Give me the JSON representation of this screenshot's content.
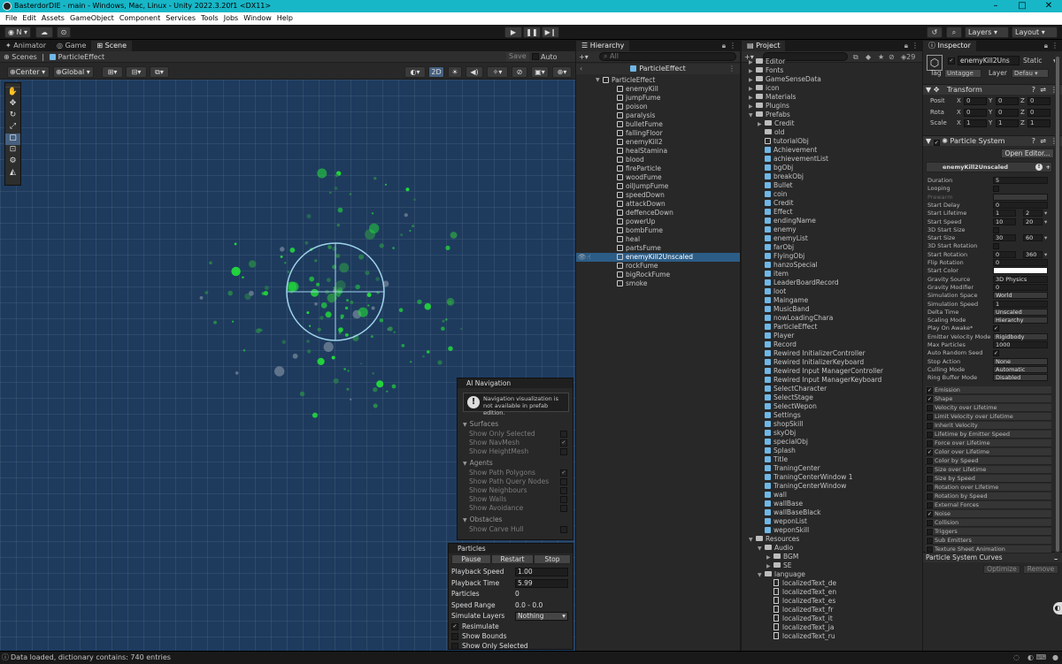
{
  "window": {
    "title": "BasterdorDIE - main - Windows, Mac, Linux - Unity 2022.3.20f1 <DX11>"
  },
  "menu": [
    "File",
    "Edit",
    "Assets",
    "GameObject",
    "Component",
    "Services",
    "Tools",
    "Jobs",
    "Window",
    "Help"
  ],
  "toolbar": {
    "account": "N",
    "layers": "Layers",
    "layout": "Layout"
  },
  "scene_panel": {
    "tabs": [
      "Animator",
      "Game",
      "Scene"
    ],
    "breadcrumb_root": "Scenes",
    "breadcrumb_item": "ParticleEffect",
    "save": "Save",
    "auto_save": "Auto Save",
    "pivot": "Center",
    "space": "Global",
    "mode_2d": "2D"
  },
  "ai_navigation": {
    "title": "AI Navigation",
    "notice": "Navigation visualization is not available in prefab edition.",
    "surfaces_label": "Surfaces",
    "surfaces": [
      {
        "label": "Show Only Selected",
        "checked": false
      },
      {
        "label": "Show NavMesh",
        "checked": true
      },
      {
        "label": "Show HeightMesh",
        "checked": false
      }
    ],
    "agents_label": "Agents",
    "agents": [
      {
        "label": "Show Path Polygons",
        "checked": true
      },
      {
        "label": "Show Path Query Nodes",
        "checked": false
      },
      {
        "label": "Show Neighbours",
        "checked": false
      },
      {
        "label": "Show Walls",
        "checked": false
      },
      {
        "label": "Show Avoidance",
        "checked": false
      }
    ],
    "obstacles_label": "Obstacles",
    "obstacles": [
      {
        "label": "Show Carve Hull",
        "checked": false
      }
    ]
  },
  "particles_overlay": {
    "title": "Particles",
    "pause": "Pause",
    "restart": "Restart",
    "stop": "Stop",
    "playback_speed_label": "Playback Speed",
    "playback_speed": "1.00",
    "playback_time_label": "Playback Time",
    "playback_time": "5.99",
    "particles_label": "Particles",
    "particles": "0",
    "speed_range_label": "Speed Range",
    "speed_range": "0.0 - 0.0",
    "simulate_layers_label": "Simulate Layers",
    "simulate_layers": "Nothing",
    "resimulate": "Resimulate",
    "show_bounds": "Show Bounds",
    "show_only_selected": "Show Only Selected"
  },
  "hierarchy": {
    "tab": "Hierarchy",
    "search_placeholder": "All",
    "root": "ParticleEffect",
    "parent": "ParticleEffect",
    "children": [
      "enemyKill",
      "jumpFume",
      "poison",
      "paralysis",
      "bulletFume",
      "fallingFloor",
      "enemyKill2",
      "healStamina",
      "blood",
      "fireParticle",
      "woodFume",
      "oilJumpFume",
      "speedDown",
      "attackDown",
      "deffenceDown",
      "powerUp",
      "bombFume",
      "heal",
      "partsFume",
      "enemyKill2Unscaled",
      "rockFume",
      "bigRockFume",
      "smoke"
    ],
    "selected": "enemyKill2Unscaled"
  },
  "project": {
    "tab": "Project",
    "count": "29",
    "items": [
      {
        "d": 1,
        "t": "folder",
        "n": "Editor",
        "a": "▶"
      },
      {
        "d": 1,
        "t": "folder",
        "n": "Fonts",
        "a": "▶"
      },
      {
        "d": 1,
        "t": "folder",
        "n": "GameSenseData",
        "a": "▶"
      },
      {
        "d": 1,
        "t": "folder",
        "n": "icon",
        "a": "▶"
      },
      {
        "d": 1,
        "t": "folder",
        "n": "Materials",
        "a": "▶"
      },
      {
        "d": 1,
        "t": "folder",
        "n": "Plugins",
        "a": "▶"
      },
      {
        "d": 1,
        "t": "folder",
        "n": "Prefabs",
        "a": "▼"
      },
      {
        "d": 2,
        "t": "folder",
        "n": "Credit",
        "a": "▶"
      },
      {
        "d": 2,
        "t": "folder",
        "n": "old",
        "a": ""
      },
      {
        "d": 2,
        "t": "cubeo",
        "n": "tutorialObj",
        "a": ""
      },
      {
        "d": 2,
        "t": "cube",
        "n": "Achievement",
        "a": ""
      },
      {
        "d": 2,
        "t": "cube",
        "n": "achievementList",
        "a": ""
      },
      {
        "d": 2,
        "t": "cube",
        "n": "bgObj",
        "a": ""
      },
      {
        "d": 2,
        "t": "cube",
        "n": "breakObj",
        "a": ""
      },
      {
        "d": 2,
        "t": "cube",
        "n": "Bullet",
        "a": ""
      },
      {
        "d": 2,
        "t": "cube",
        "n": "coin",
        "a": ""
      },
      {
        "d": 2,
        "t": "cube",
        "n": "Credit",
        "a": ""
      },
      {
        "d": 2,
        "t": "cube",
        "n": "Effect",
        "a": ""
      },
      {
        "d": 2,
        "t": "cube",
        "n": "endingName",
        "a": ""
      },
      {
        "d": 2,
        "t": "cube",
        "n": "enemy",
        "a": ""
      },
      {
        "d": 2,
        "t": "cube",
        "n": "enemyList",
        "a": ""
      },
      {
        "d": 2,
        "t": "cube",
        "n": "farObj",
        "a": ""
      },
      {
        "d": 2,
        "t": "cube",
        "n": "FlyingObj",
        "a": ""
      },
      {
        "d": 2,
        "t": "cube",
        "n": "hanzoSpecial",
        "a": ""
      },
      {
        "d": 2,
        "t": "cube",
        "n": "item",
        "a": ""
      },
      {
        "d": 2,
        "t": "cube",
        "n": "LeaderBoardRecord",
        "a": ""
      },
      {
        "d": 2,
        "t": "cube",
        "n": "loot",
        "a": ""
      },
      {
        "d": 2,
        "t": "cube",
        "n": "Maingame",
        "a": ""
      },
      {
        "d": 2,
        "t": "cube",
        "n": "MusicBand",
        "a": ""
      },
      {
        "d": 2,
        "t": "cube",
        "n": "nowLoadingChara",
        "a": ""
      },
      {
        "d": 2,
        "t": "cube",
        "n": "ParticleEffect",
        "a": ""
      },
      {
        "d": 2,
        "t": "cube",
        "n": "Player",
        "a": ""
      },
      {
        "d": 2,
        "t": "cube",
        "n": "Record",
        "a": ""
      },
      {
        "d": 2,
        "t": "cube",
        "n": "Rewired InitializerController",
        "a": ""
      },
      {
        "d": 2,
        "t": "cube",
        "n": "Rewired InitializerKeyboard",
        "a": ""
      },
      {
        "d": 2,
        "t": "cube",
        "n": "Rewired Input ManagerController",
        "a": ""
      },
      {
        "d": 2,
        "t": "cube",
        "n": "Rewired Input ManagerKeyboard",
        "a": ""
      },
      {
        "d": 2,
        "t": "cube",
        "n": "SelectCharacter",
        "a": ""
      },
      {
        "d": 2,
        "t": "cube",
        "n": "SelectStage",
        "a": ""
      },
      {
        "d": 2,
        "t": "cube",
        "n": "SelectWepon",
        "a": ""
      },
      {
        "d": 2,
        "t": "cube",
        "n": "Settings",
        "a": ""
      },
      {
        "d": 2,
        "t": "cube",
        "n": "shopSkill",
        "a": ""
      },
      {
        "d": 2,
        "t": "cube",
        "n": "skyObj",
        "a": ""
      },
      {
        "d": 2,
        "t": "cube",
        "n": "specialObj",
        "a": ""
      },
      {
        "d": 2,
        "t": "cube",
        "n": "Splash",
        "a": ""
      },
      {
        "d": 2,
        "t": "cube",
        "n": "Title",
        "a": ""
      },
      {
        "d": 2,
        "t": "cube",
        "n": "TraningCenter",
        "a": ""
      },
      {
        "d": 2,
        "t": "cube",
        "n": "TraningCenterWindow 1",
        "a": ""
      },
      {
        "d": 2,
        "t": "cube",
        "n": "TraningCenterWindow",
        "a": ""
      },
      {
        "d": 2,
        "t": "cube",
        "n": "wall",
        "a": ""
      },
      {
        "d": 2,
        "t": "cube",
        "n": "wallBase",
        "a": ""
      },
      {
        "d": 2,
        "t": "cube",
        "n": "wallBaseBlack",
        "a": ""
      },
      {
        "d": 2,
        "t": "cube",
        "n": "weponList",
        "a": ""
      },
      {
        "d": 2,
        "t": "cube",
        "n": "weponSkill",
        "a": ""
      },
      {
        "d": 1,
        "t": "folder",
        "n": "Resources",
        "a": "▼"
      },
      {
        "d": 2,
        "t": "folder",
        "n": "Audio",
        "a": "▼"
      },
      {
        "d": 3,
        "t": "folder",
        "n": "BGM",
        "a": "▶"
      },
      {
        "d": 3,
        "t": "folder",
        "n": "SE",
        "a": "▶"
      },
      {
        "d": 2,
        "t": "folder",
        "n": "language",
        "a": "▼"
      },
      {
        "d": 3,
        "t": "file",
        "n": "localizedText_de",
        "a": ""
      },
      {
        "d": 3,
        "t": "file",
        "n": "localizedText_en",
        "a": ""
      },
      {
        "d": 3,
        "t": "file",
        "n": "localizedText_es",
        "a": ""
      },
      {
        "d": 3,
        "t": "file",
        "n": "localizedText_fr",
        "a": ""
      },
      {
        "d": 3,
        "t": "file",
        "n": "localizedText_it",
        "a": ""
      },
      {
        "d": 3,
        "t": "file",
        "n": "localizedText_ja",
        "a": ""
      },
      {
        "d": 3,
        "t": "file",
        "n": "localizedText_ru",
        "a": ""
      }
    ]
  },
  "inspector": {
    "tab": "Inspector",
    "object_name": "enemyKill2Uns",
    "static_label": "Static",
    "tag_label": "Tag",
    "tag_value": "Untagge",
    "layer_label": "Layer",
    "layer_value": "Defau",
    "transform_title": "Transform",
    "transform_rows": [
      {
        "label": "Posit",
        "x": "0",
        "y": "0",
        "z": "0"
      },
      {
        "label": "Rota",
        "x": "0",
        "y": "0",
        "z": "0"
      },
      {
        "label": "Scale",
        "x": "1",
        "y": "1",
        "z": "1"
      }
    ],
    "particle_system_title": "Particle System",
    "open_editor": "Open Editor...",
    "system_name": "enemyKill2Unscaled",
    "props": [
      {
        "l": "Duration",
        "v": "5"
      },
      {
        "l": "Looping",
        "v": "",
        "cb": true
      },
      {
        "l": "Prewarm",
        "v": "",
        "dim": true
      },
      {
        "l": "Start Delay",
        "v": "0"
      },
      {
        "l": "Start Lifetime",
        "v": "1",
        "v2": "2"
      },
      {
        "l": "Start Speed",
        "v": "10",
        "v2": "20"
      },
      {
        "l": "3D Start Size",
        "v": "",
        "cb": true
      },
      {
        "l": "Start Size",
        "v": "30",
        "v2": "60"
      },
      {
        "l": "3D Start Rotation",
        "v": "",
        "cb": true
      },
      {
        "l": "Start Rotation",
        "v": "0",
        "v2": "360"
      },
      {
        "l": "Flip Rotation",
        "v": "0"
      },
      {
        "l": "Start Color",
        "v": ""
      },
      {
        "l": "Gravity Source",
        "v": "3D Physics"
      },
      {
        "l": "Gravity Modifier",
        "v": "0"
      },
      {
        "l": "Simulation Space",
        "v": "World"
      },
      {
        "l": "Simulation Speed",
        "v": "1"
      },
      {
        "l": "Delta Time",
        "v": "Unscaled"
      },
      {
        "l": "Scaling Mode",
        "v": "Hierarchy"
      },
      {
        "l": "Play On Awake*",
        "v": "",
        "cb": true,
        "checked": true
      },
      {
        "l": "Emitter Velocity Mode",
        "v": "Rigidbody"
      },
      {
        "l": "Max Particles",
        "v": "1000"
      },
      {
        "l": "Auto Random Seed",
        "v": "",
        "cb": true,
        "checked": true
      },
      {
        "l": "Stop Action",
        "v": "None"
      },
      {
        "l": "Culling Mode",
        "v": "Automatic"
      },
      {
        "l": "Ring Buffer Mode",
        "v": "Disabled"
      }
    ],
    "modules": [
      {
        "l": "Emission",
        "on": true
      },
      {
        "l": "Shape",
        "on": true
      },
      {
        "l": "Velocity over Lifetime",
        "on": false
      },
      {
        "l": "Limit Velocity over Lifetime",
        "on": false
      },
      {
        "l": "Inherit Velocity",
        "on": false
      },
      {
        "l": "Lifetime by Emitter Speed",
        "on": false
      },
      {
        "l": "Force over Lifetime",
        "on": false
      },
      {
        "l": "Color over Lifetime",
        "on": true
      },
      {
        "l": "Color by Speed",
        "on": false
      },
      {
        "l": "Size over Lifetime",
        "on": false
      },
      {
        "l": "Size by Speed",
        "on": false
      },
      {
        "l": "Rotation over Lifetime",
        "on": false
      },
      {
        "l": "Rotation by Speed",
        "on": false
      },
      {
        "l": "External Forces",
        "on": false
      },
      {
        "l": "Noise",
        "on": true
      },
      {
        "l": "Collision",
        "on": false
      },
      {
        "l": "Triggers",
        "on": false
      },
      {
        "l": "Sub Emitters",
        "on": false
      },
      {
        "l": "Texture Sheet Animation",
        "on": false
      }
    ],
    "curves_title": "Particle System Curves",
    "optimize": "Optimize",
    "remove": "Remove"
  },
  "status": {
    "message": "Data loaded, dictionary contains: 740 entries"
  }
}
